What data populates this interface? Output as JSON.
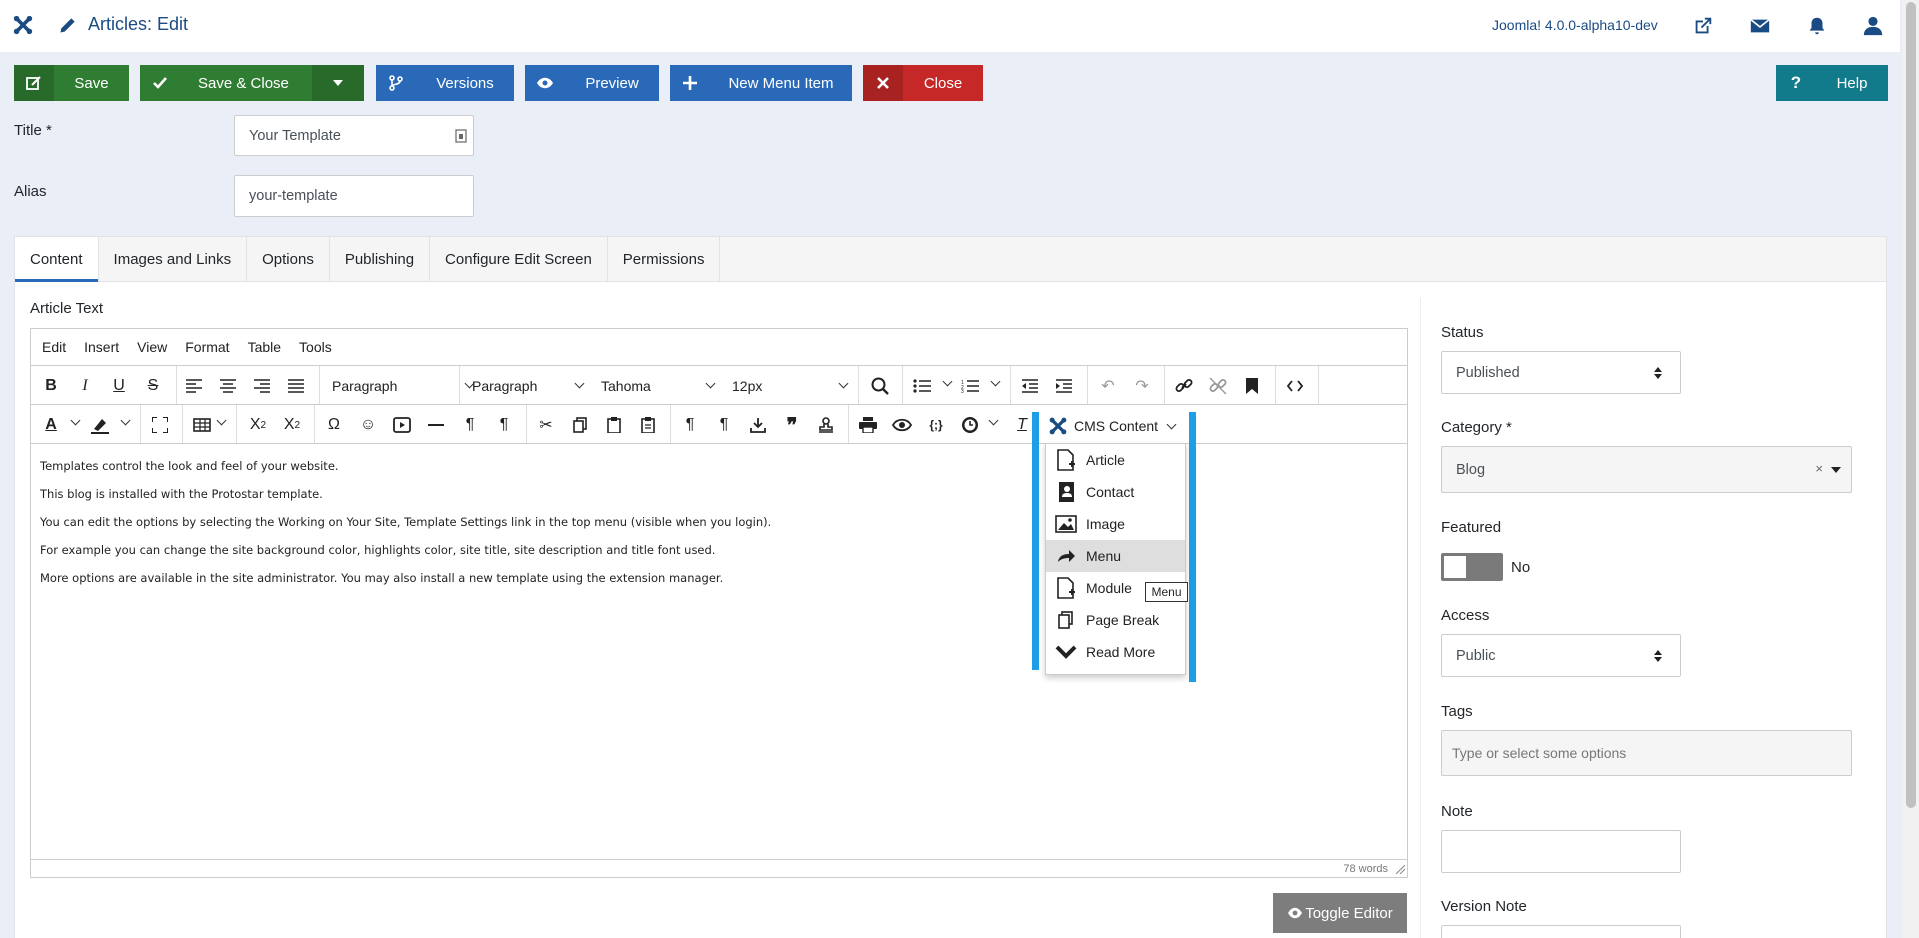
{
  "header": {
    "title": "Articles: Edit",
    "version": "Joomla! 4.0.0-alpha10-dev"
  },
  "toolbar": {
    "save": "Save",
    "save_close": "Save & Close",
    "versions": "Versions",
    "preview": "Preview",
    "new_menu_item": "New Menu Item",
    "close": "Close",
    "help": "Help"
  },
  "form": {
    "title_label": "Title *",
    "title_value": "Your Template",
    "alias_label": "Alias",
    "alias_value": "your-template"
  },
  "tabs": [
    {
      "label": "Content",
      "active": true
    },
    {
      "label": "Images and Links"
    },
    {
      "label": "Options"
    },
    {
      "label": "Publishing"
    },
    {
      "label": "Configure Edit Screen"
    },
    {
      "label": "Permissions"
    }
  ],
  "editor": {
    "label": "Article Text",
    "menubar": [
      "Edit",
      "Insert",
      "View",
      "Format",
      "Table",
      "Tools"
    ],
    "format1": "Paragraph",
    "format2": "Paragraph",
    "font_family": "Tahoma",
    "font_size": "12px",
    "cms_content": "CMS Content",
    "paragraphs": [
      "Templates control the look and feel of your website.",
      "This blog is installed with the Protostar template.",
      "You can edit the options by selecting the Working on Your Site, Template Settings link in the top menu (visible when you login).",
      "For example you can change the site background color, highlights color, site title, site description and title font used.",
      "More options are available in the site administrator. You may also install a new template using the extension manager."
    ],
    "word_count": "78 words",
    "toggle_editor": "Toggle Editor"
  },
  "cms_menu": {
    "items": [
      "Article",
      "Contact",
      "Image",
      "Menu",
      "Module",
      "Page Break",
      "Read More"
    ],
    "hovered": "Menu",
    "tooltip": "Menu"
  },
  "sidebar": {
    "status_label": "Status",
    "status_value": "Published",
    "category_label": "Category *",
    "category_value": "Blog",
    "category_clear": "×",
    "featured_label": "Featured",
    "featured_value": "No",
    "access_label": "Access",
    "access_value": "Public",
    "tags_label": "Tags",
    "tags_placeholder": "Type or select some options",
    "note_label": "Note",
    "version_note_label": "Version Note"
  },
  "colors": {
    "header_text": "#1a4b83",
    "save_green": "#2f7d32",
    "action_blue": "#2a69b8",
    "close_red": "#c52827",
    "help_teal": "#117a8b",
    "dropdown_highlight": "#1e9ee6"
  }
}
